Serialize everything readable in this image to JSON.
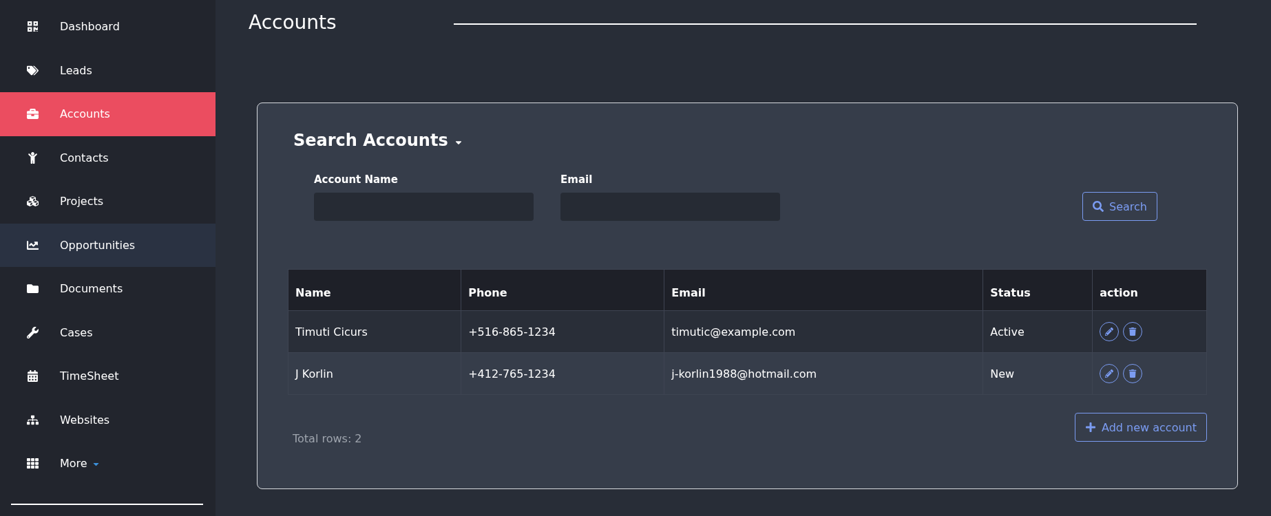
{
  "sidebar": {
    "items": [
      {
        "label": "Dashboard",
        "selected": false,
        "hovered": false
      },
      {
        "label": "Leads",
        "selected": false,
        "hovered": false
      },
      {
        "label": "Accounts",
        "selected": true,
        "hovered": false
      },
      {
        "label": "Contacts",
        "selected": false,
        "hovered": false
      },
      {
        "label": "Projects",
        "selected": false,
        "hovered": false
      },
      {
        "label": "Opportunities",
        "selected": false,
        "hovered": true
      },
      {
        "label": "Documents",
        "selected": false,
        "hovered": false
      },
      {
        "label": "Cases",
        "selected": false,
        "hovered": false
      },
      {
        "label": "TimeSheet",
        "selected": false,
        "hovered": false
      },
      {
        "label": "Websites",
        "selected": false,
        "hovered": false
      },
      {
        "label": "More",
        "selected": false,
        "hovered": false,
        "dropdown": true
      }
    ]
  },
  "page": {
    "title": "Accounts"
  },
  "search_panel": {
    "title": "Search Accounts",
    "fields": [
      {
        "label": "Account Name"
      },
      {
        "label": "Email"
      }
    ],
    "search_button": "Search"
  },
  "table": {
    "columns": [
      "Name",
      "Phone",
      "Email",
      "Status",
      "action"
    ],
    "rows": [
      [
        "Timuti Cicurs",
        "+516-865-1234",
        "timutic@example.com",
        "Active"
      ],
      [
        "J Korlin",
        "+412-765-1234",
        "j-korlin1988@hotmail.com",
        "New"
      ]
    ]
  },
  "total_rows": "Total rows: 2",
  "add_button": "Add new account"
}
